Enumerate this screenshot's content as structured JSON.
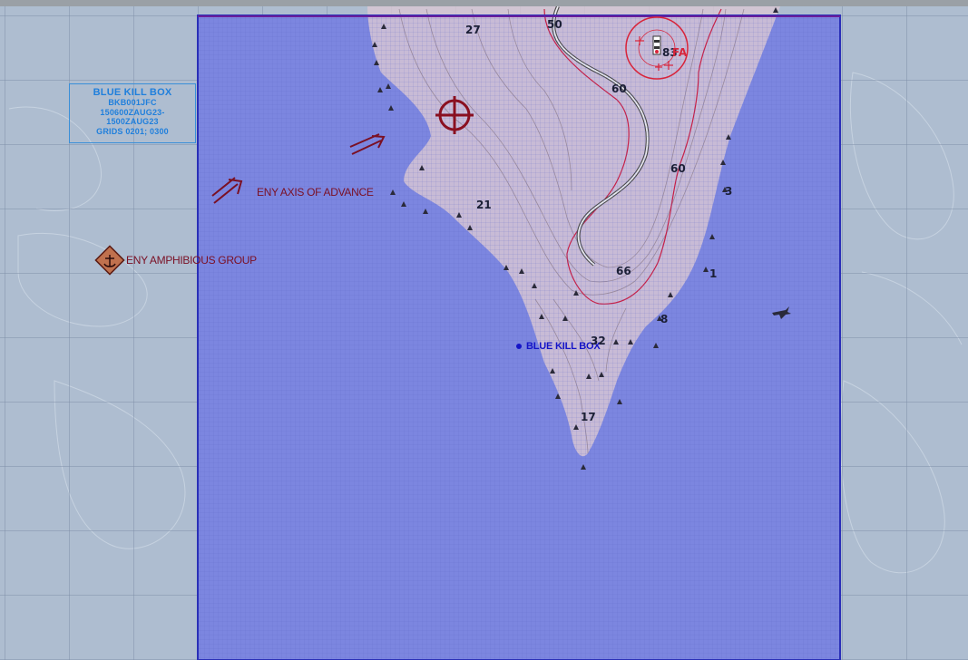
{
  "colors": {
    "sea": "#aebdd0",
    "killbox_fill": "#7c86e0",
    "killbox_border": "#2a2fb8",
    "land": "#d7c3ce",
    "enemy": "#7a1024",
    "friendly_text": "#1414c8",
    "card_text": "#1f7fdc",
    "target_red": "#d8243a"
  },
  "killbox_card": {
    "title": "BLUE KILL BOX",
    "line1": "BKB001JFC",
    "line2": "150600ZAUG23-",
    "line3": "1500ZAUG23",
    "line4": "GRIDS 0201; 0300"
  },
  "labels": {
    "axis_of_advance": "ENY AXIS OF ADVANCE",
    "amphibious_group": "ENY AMPHIBIOUS GROUP",
    "kill_box": "BLUE KILL BOX",
    "fa": "FA",
    "fa_num": "83"
  },
  "depths": [
    "27",
    "50",
    "60",
    "60",
    "3",
    "21",
    "66",
    "1",
    "8",
    "32",
    "17"
  ],
  "icons": {
    "target": "crosshair-target-icon",
    "anchor": "anchor-icon",
    "aircraft": "aircraft-icon",
    "arrow": "double-arrow-icon",
    "lighthouse": "lighthouse-icon"
  }
}
